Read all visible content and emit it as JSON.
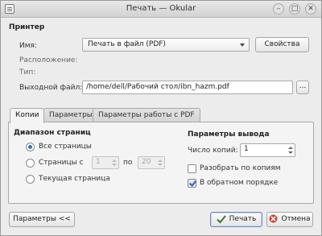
{
  "window": {
    "title": "Печать — Okular"
  },
  "printer": {
    "section_title": "Принтер",
    "name_label": "Имя:",
    "name_value": "Печать в файл (PDF)",
    "properties_button": "Свойства",
    "location_label": "Расположение:",
    "type_label": "Тип:",
    "output_label": "Выходной файл:",
    "output_value": "/home/dell/Рабочий стол/ibn_hazm.pdf",
    "browse_button": "..."
  },
  "tabs": [
    {
      "label": "Копии"
    },
    {
      "label": "Параметры"
    },
    {
      "label": "Параметры работы с PDF"
    }
  ],
  "copies": {
    "range_title": "Диапазон страниц",
    "all_pages": "Все страницы",
    "pages_from": "Страницы с",
    "from_value": "1",
    "to_label": "по",
    "to_value": "20",
    "current_page": "Текущая страница",
    "output_title": "Параметры вывода",
    "copies_label": "Число копий:",
    "copies_value": "1",
    "collate_label": "Разобрать по копиям",
    "reverse_label": "В обратном порядке"
  },
  "footer": {
    "options_button": "Параметры <<",
    "print_button": "Печать",
    "cancel_button": "Отмена"
  }
}
